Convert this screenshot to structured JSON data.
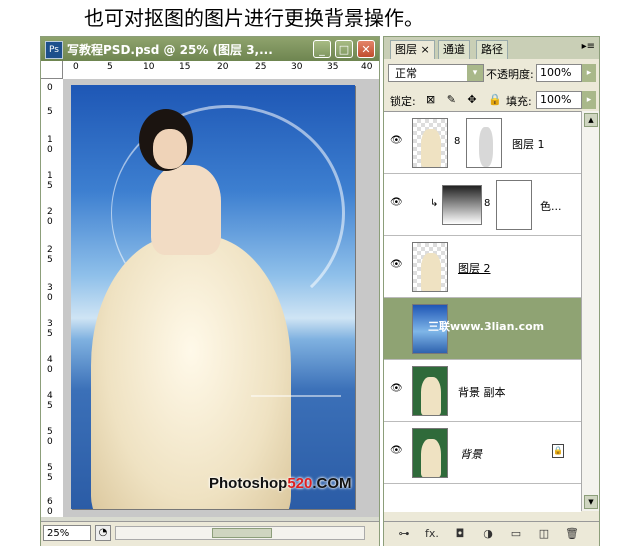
{
  "caption": "也可对抠图的图片进行更换背景操作。",
  "document": {
    "ps_badge": "Ps",
    "title": "写教程PSD.psd @ 25% (图层 3,...",
    "minimize": "_",
    "maximize": "□",
    "close": "✕",
    "ruler_h_labels": [
      "0",
      "5",
      "10",
      "15",
      "20",
      "25",
      "30",
      "35",
      "40"
    ],
    "ruler_v_labels": [
      "0",
      "5",
      "1 0",
      "1 5",
      "2 0",
      "2 5",
      "3 0",
      "3 5",
      "4 0",
      "4 5",
      "5 0",
      "5 5",
      "6 0"
    ],
    "watermark_prefix": "Photoshop",
    "watermark_number": "520",
    "watermark_suffix": ".COM",
    "zoom": "25%",
    "status_icon": "◔"
  },
  "panel": {
    "tabs": [
      "图层 ×",
      "通道",
      "路径"
    ],
    "menu_icon": "▸≡",
    "blend_mode": "正常",
    "opacity_label": "不透明度:",
    "opacity_value": "100%",
    "lock_label": "锁定:",
    "lock_icons": "⊠ ✎ ✥ 🔒",
    "fill_label": "填充:",
    "fill_value": "100%",
    "arrow": "▸",
    "dropdown": "▾",
    "eye": "👁",
    "link": "8",
    "layers": [
      {
        "name": "图层 1"
      },
      {
        "name": "色..."
      },
      {
        "name": "图层 2"
      },
      {
        "name": "",
        "overlay": "三联www.3lian.com"
      },
      {
        "name": "背景 副本"
      },
      {
        "name": "背景",
        "lock": "🔒"
      }
    ],
    "footer_icons": [
      "⊶",
      "fx.",
      "◘",
      "◑",
      "▭",
      "◫",
      "🗑"
    ]
  },
  "colors": {
    "window_accent": "#8fa36d",
    "selected_layer": "#8fa373",
    "watermark_red": "#e02020"
  }
}
